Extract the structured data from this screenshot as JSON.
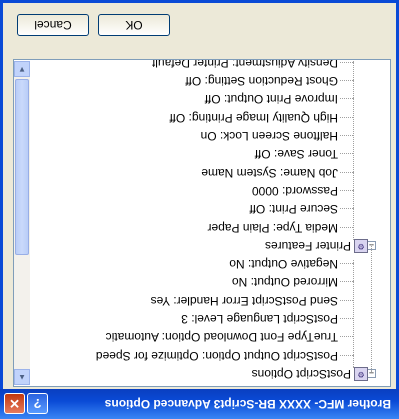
{
  "window": {
    "title": "Brother MFC- XXXX    BR-Script3 Advanced Options",
    "help_label": "?",
    "close_label": "✕"
  },
  "tree": {
    "groups": [
      {
        "label": "PostScript Options",
        "expander": "−",
        "icon": "printer-settings-icon",
        "items": [
          "PostScript Output Option: Optimize for Speed",
          "TrueType Font Download Option: Automatic",
          "PostScript Language Level: 3",
          "Send PostScript Error Handler: Yes",
          "Mirrored Output: No",
          "Negative Output: No"
        ]
      },
      {
        "label": "Printer Features",
        "expander": "−",
        "icon": "printer-settings-icon",
        "items": [
          "Media Type: Plain Paper",
          "Secure Print: Off",
          "Password: 0000",
          "Job Name: System Name",
          "Toner Save: Off",
          "Halftone Screen Lock: On",
          "High Quality Image Printing: Off",
          "Improve Print Output: Off",
          "Ghost Reduction Setting: Off",
          "Density Adjustment: Printer Default"
        ]
      }
    ]
  },
  "buttons": {
    "ok": "OK",
    "cancel": "Cancel"
  },
  "colors": {
    "titlebar": "#0a4ad6",
    "dialog_bg": "#ece9d8",
    "close": "#c2370d"
  }
}
